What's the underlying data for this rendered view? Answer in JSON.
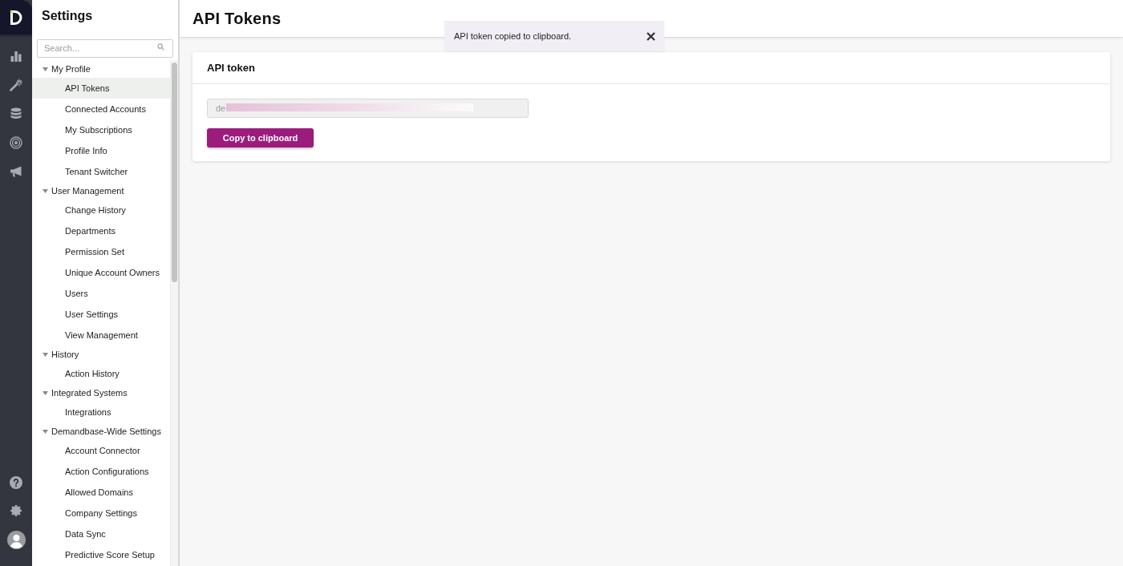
{
  "sidebar": {
    "title": "Settings",
    "search": {
      "placeholder": "Search..."
    },
    "tree": [
      {
        "label": "My Profile",
        "expanded": true,
        "selected": false,
        "children": [
          {
            "label": "API Tokens",
            "selected": true
          },
          {
            "label": "Connected Accounts",
            "selected": false
          },
          {
            "label": "My Subscriptions",
            "selected": false
          },
          {
            "label": "Profile Info",
            "selected": false
          },
          {
            "label": "Tenant Switcher",
            "selected": false
          }
        ]
      },
      {
        "label": "User Management",
        "expanded": true,
        "selected": false,
        "children": [
          {
            "label": "Change History",
            "selected": false
          },
          {
            "label": "Departments",
            "selected": false
          },
          {
            "label": "Permission Set",
            "selected": false
          },
          {
            "label": "Unique Account Owners",
            "selected": false
          },
          {
            "label": "Users",
            "selected": false
          },
          {
            "label": "User Settings",
            "selected": false
          },
          {
            "label": "View Management",
            "selected": false
          }
        ]
      },
      {
        "label": "History",
        "expanded": true,
        "selected": false,
        "children": [
          {
            "label": "Action History",
            "selected": false
          }
        ]
      },
      {
        "label": "Integrated Systems",
        "expanded": true,
        "selected": false,
        "children": [
          {
            "label": "Integrations",
            "selected": false
          }
        ]
      },
      {
        "label": "Demandbase-Wide Settings",
        "expanded": true,
        "selected": false,
        "children": [
          {
            "label": "Account Connector",
            "selected": false
          },
          {
            "label": "Action Configurations",
            "selected": false
          },
          {
            "label": "Allowed Domains",
            "selected": false
          },
          {
            "label": "Company Settings",
            "selected": false
          },
          {
            "label": "Data Sync",
            "selected": false
          },
          {
            "label": "Predictive Score Setup",
            "selected": false
          }
        ]
      }
    ]
  },
  "header": {
    "title": "API Tokens"
  },
  "toast": {
    "message": "API token copied to clipboard."
  },
  "card": {
    "title": "API token",
    "token_field": {
      "value": "de",
      "redacted": true
    },
    "copy_button": "Copy to clipboard"
  }
}
